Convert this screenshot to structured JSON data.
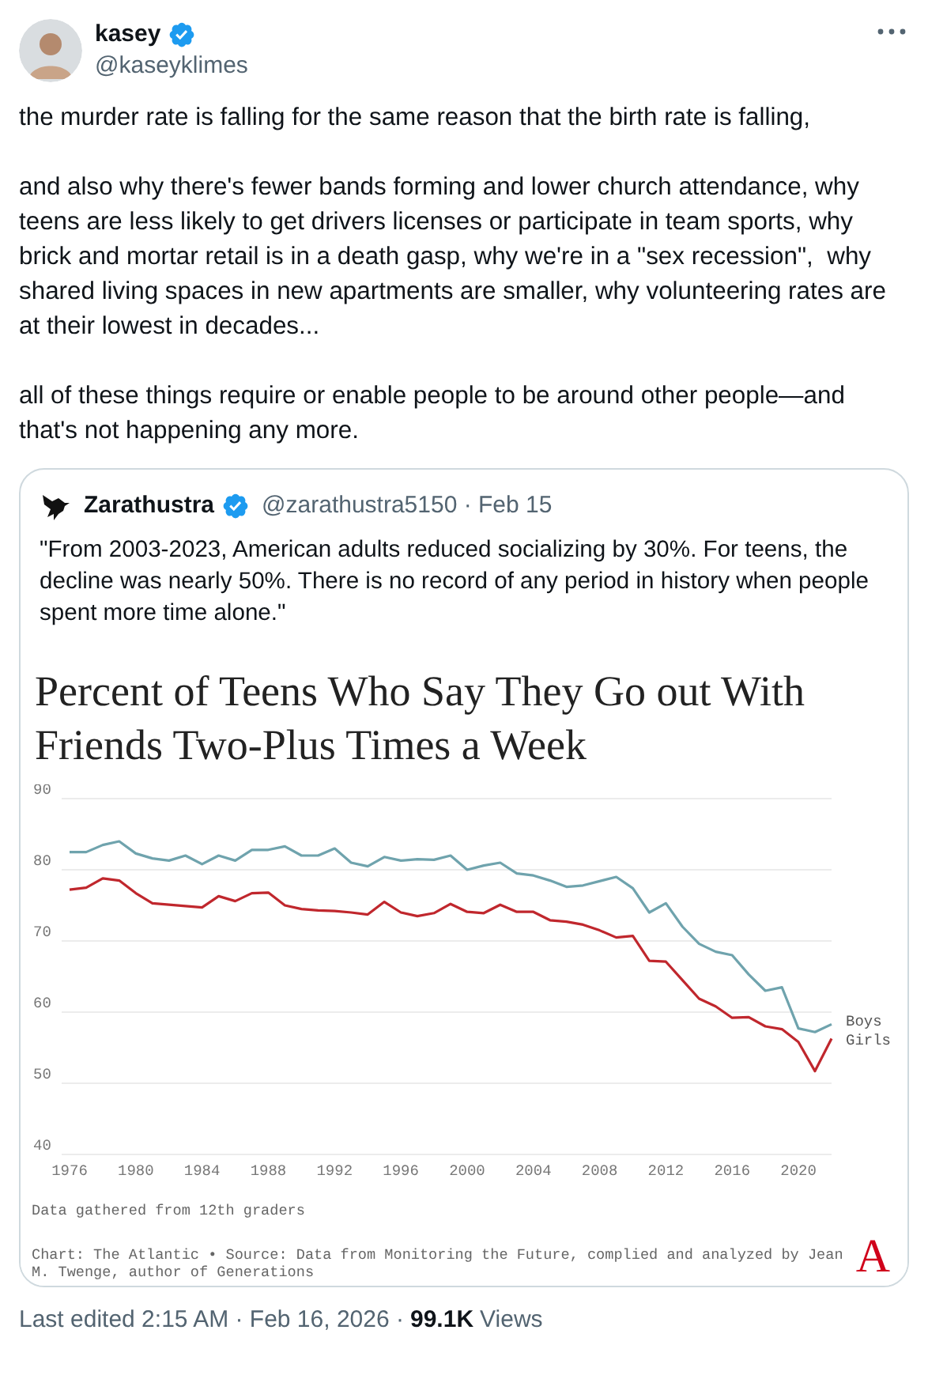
{
  "author": {
    "name": "kasey",
    "handle": "@kaseyklimes",
    "verified": true
  },
  "tweet_text": [
    "the murder rate is falling for the same reason that the birth rate is falling,",
    "and also why there's fewer bands forming and lower church attendance, why teens are less likely to get drivers licenses or participate in team sports, why brick and mortar retail is in a death gasp, why we're in a \"sex recession\",  why shared living spaces in new apartments are smaller, why volunteering rates are at their lowest in decades...",
    "all of these things require or enable people to be around other people—and that's not happening any more."
  ],
  "quote": {
    "author": {
      "name": "Zarathustra",
      "verified": true,
      "meta": "@zarathustra5150 · Feb 15"
    },
    "text": "\"From 2003-2023, American adults reduced socializing by 30%. For teens, the decline was nearly 50%. There is no record of any period in history when people spent more time alone.\"",
    "chart": {
      "chart_data": {
        "type": "line",
        "title": "Percent of Teens Who Say They Go out With Friends Two-Plus Times a Week",
        "x": [
          1976,
          1977,
          1978,
          1979,
          1980,
          1981,
          1982,
          1983,
          1984,
          1985,
          1986,
          1987,
          1988,
          1989,
          1990,
          1991,
          1992,
          1993,
          1994,
          1995,
          1996,
          1997,
          1998,
          1999,
          2000,
          2001,
          2002,
          2003,
          2004,
          2005,
          2006,
          2007,
          2008,
          2009,
          2010,
          2011,
          2012,
          2013,
          2014,
          2015,
          2016,
          2017,
          2018,
          2019,
          2020,
          2021,
          2022
        ],
        "series": [
          {
            "name": "Boys",
            "color": "#6fa3ad",
            "values": [
              82.5,
              82.5,
              83.5,
              84,
              82.3,
              81.6,
              81.3,
              82,
              80.8,
              82,
              81.3,
              82.8,
              82.8,
              83.3,
              82,
              82,
              83,
              81,
              80.5,
              81.8,
              81.3,
              81.5,
              81.4,
              82,
              80,
              80.6,
              81,
              79.5,
              79.2,
              78.5,
              77.6,
              77.8,
              78.4,
              79,
              77.4,
              74,
              75.3,
              72,
              69.6,
              68.5,
              68,
              65.3,
              63,
              63.5,
              57.7,
              57.2,
              58.3
            ]
          },
          {
            "name": "Girls",
            "color": "#c0272d",
            "values": [
              77.2,
              77.5,
              78.8,
              78.5,
              76.7,
              75.3,
              75.1,
              74.9,
              74.7,
              76.3,
              75.6,
              76.7,
              76.8,
              75,
              74.5,
              74.3,
              74.2,
              74,
              73.7,
              75.5,
              74,
              73.5,
              73.9,
              75.2,
              74.1,
              73.9,
              75.1,
              74.1,
              74.1,
              72.9,
              72.7,
              72.3,
              71.5,
              70.5,
              70.7,
              67.2,
              67.1,
              64.5,
              61.9,
              60.8,
              59.2,
              59.3,
              58,
              57.6,
              55.8,
              51.7,
              56.3
            ]
          }
        ],
        "xlim": [
          1976,
          2022
        ],
        "ylim": [
          40,
          90
        ],
        "grid": true,
        "yticks": [
          40,
          50,
          60,
          70,
          80,
          90
        ],
        "xticks": [
          1976,
          1980,
          1984,
          1988,
          1992,
          1996,
          2000,
          2004,
          2008,
          2012,
          2016,
          2020
        ]
      },
      "note": "Data gathered from 12th graders",
      "source": "Chart: The Atlantic • Source: Data from Monitoring the Future, complied and analyzed by Jean M. Twenge, author of Generations",
      "logo_text": "A"
    }
  },
  "footer": {
    "edited": "Last edited 2:15 AM · Feb 16, 2026 ·",
    "views_count": "99.1K",
    "views_label": "Views"
  }
}
